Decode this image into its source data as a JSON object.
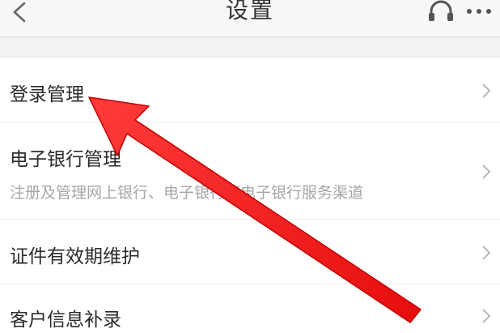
{
  "header": {
    "title": "设置",
    "back_icon": "chevron-left-icon",
    "support_icon": "headset-icon",
    "more_icon": "more-horizontal-icon"
  },
  "menu": {
    "items": [
      {
        "label": "登录管理",
        "icon": "chevron-right-icon"
      },
      {
        "label": "电子银行管理",
        "subtitle": "注册及管理网上银行、电子银行等电子银行服务渠道",
        "icon": "chevron-right-icon"
      },
      {
        "label": "证件有效期维护",
        "icon": "chevron-right-icon"
      },
      {
        "label": "客户信息补录",
        "icon": "chevron-right-icon"
      }
    ]
  },
  "annotation": {
    "color": "#ee1111",
    "shape": "red-arrow"
  },
  "colors": {
    "background": "#f3f3f5",
    "text": "#2b2b2b",
    "subtext": "#a6a6aa"
  }
}
